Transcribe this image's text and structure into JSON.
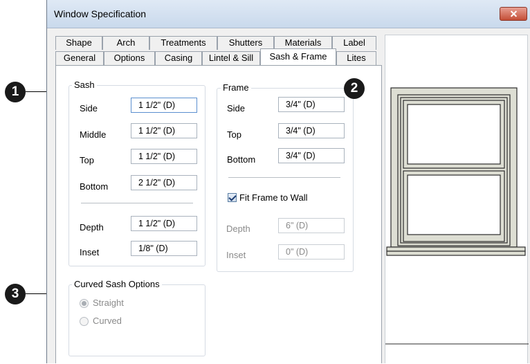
{
  "callouts": [
    "1",
    "2",
    "3"
  ],
  "dialog": {
    "title": "Window Specification"
  },
  "tabs": {
    "row1": [
      "Shape",
      "Arch",
      "Treatments",
      "Shutters",
      "Materials",
      "Label"
    ],
    "row2": [
      "General",
      "Options",
      "Casing",
      "Lintel & Sill",
      "Sash & Frame",
      "Lites"
    ],
    "active": "Sash & Frame"
  },
  "sash": {
    "title": "Sash",
    "side": {
      "label": "Side",
      "value": "1 1/2\" (D)"
    },
    "middle": {
      "label": "Middle",
      "value": "1 1/2\" (D)"
    },
    "top": {
      "label": "Top",
      "value": "1 1/2\" (D)"
    },
    "bottom": {
      "label": "Bottom",
      "value": "2 1/2\" (D)"
    },
    "depth": {
      "label": "Depth",
      "value": "1 1/2\" (D)"
    },
    "inset": {
      "label": "Inset",
      "value": "1/8\" (D)"
    }
  },
  "frame": {
    "title": "Frame",
    "side": {
      "label": "Side",
      "value": "3/4\" (D)"
    },
    "top": {
      "label": "Top",
      "value": "3/4\" (D)"
    },
    "bottom": {
      "label": "Bottom",
      "value": "3/4\" (D)"
    },
    "fit_to_wall": {
      "label": "Fit Frame to Wall",
      "checked": true
    },
    "depth": {
      "label": "Depth",
      "value": "6\" (D)"
    },
    "inset": {
      "label": "Inset",
      "value": "0\" (D)"
    }
  },
  "curved": {
    "title": "Curved Sash Options",
    "straight": {
      "label": "Straight",
      "selected": true
    },
    "curved": {
      "label": "Curved",
      "selected": false
    }
  },
  "colors": {
    "window_trim": "#ddded3",
    "window_line": "#2b2b2b",
    "callout_bg": "#1a1a1a"
  }
}
